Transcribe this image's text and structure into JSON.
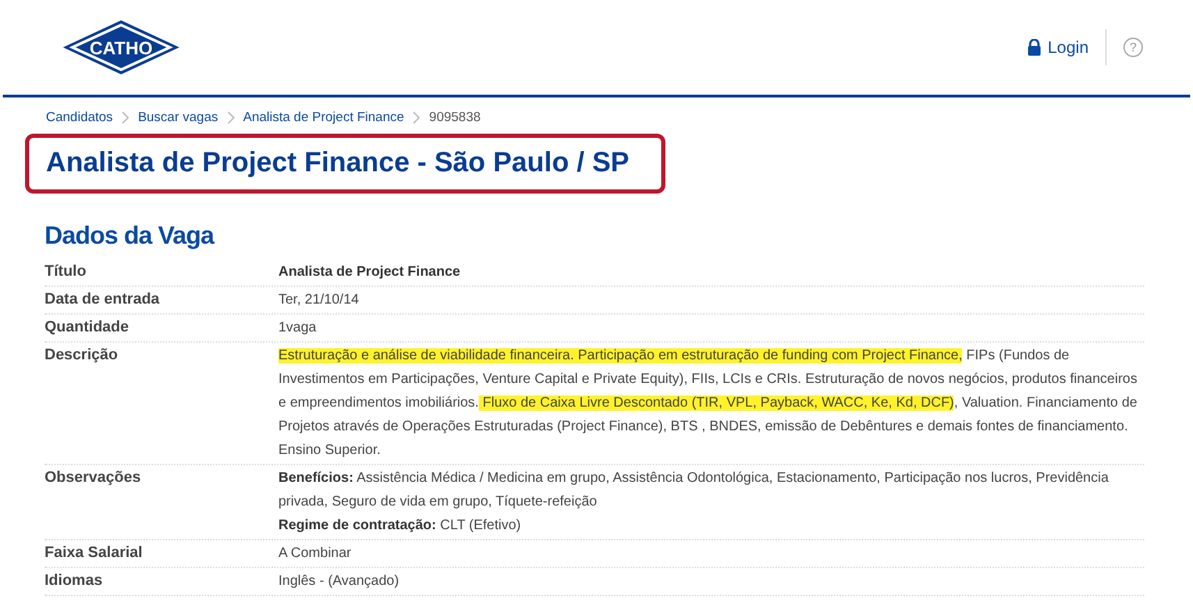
{
  "header": {
    "logo": "CATHO",
    "login": "Login",
    "help": "?"
  },
  "breadcrumbs": [
    {
      "label": "Candidatos",
      "link": true
    },
    {
      "label": "Buscar vagas",
      "link": true
    },
    {
      "label": "Analista de Project Finance",
      "link": true
    },
    {
      "label": "9095838",
      "link": false
    }
  ],
  "title": "Analista de Project Finance - São Paulo / SP",
  "section_title": "Dados da Vaga",
  "rows": [
    {
      "label": "Título",
      "lines": [
        "**Analista de Project Finance**"
      ]
    },
    {
      "label": "Data de entrada",
      "lines": [
        "Ter, 21/10/14"
      ]
    },
    {
      "label": "Quantidade",
      "lines": [
        "1vaga"
      ]
    },
    {
      "label": "Descrição",
      "paragraphs": [
        [
          {
            "text": "Estruturação e análise de viabilidade financeira. Participação em estruturação de funding com Project Finance,",
            "highlighted": true
          },
          {
            "text": " FIPs (Fundos de Investimentos em Participações, Venture Capital e Private Equity), FIIs, LCIs e CRIs. Estruturação de novos negócios, produtos financeiros e empreendimentos imobiliários.",
            "highlighted": false
          },
          {
            "text": " Fluxo de Caixa Livre Descontado (TIR, VPL, Payback, WACC, Ke, Kd, DCF)",
            "highlighted": true
          },
          {
            "text": ", Valuation. Financiamento de Projetos através de Operações Estruturadas (Project Finance), BTS , BNDES, emissão de Debêntures e demais fontes de financiamento.",
            "highlighted": false
          }
        ],
        [
          {
            "text": "Ensino Superior.",
            "highlighted": false
          }
        ]
      ]
    },
    {
      "label": "Observações",
      "lines": [
        "**Benefícios:** Assistência Médica / Medicina em grupo, Assistência Odontológica, Estacionamento, Participação nos lucros, Previdência privada, Seguro de vida em grupo, Tíquete-refeição",
        "**Regime de contratação:** CLT (Efetivo)"
      ]
    },
    {
      "label": "Faixa Salarial",
      "lines": [
        "A Combinar"
      ]
    },
    {
      "label": "Idiomas",
      "lines": [
        "Inglês - (Avançado)"
      ]
    }
  ]
}
